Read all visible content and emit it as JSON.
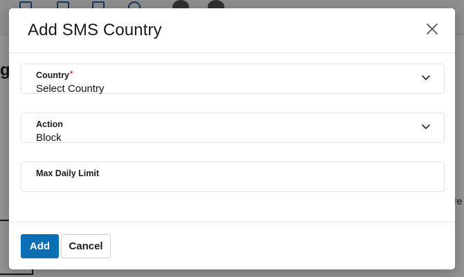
{
  "modal": {
    "title": "Add SMS Country",
    "close_icon": "close-icon"
  },
  "fields": {
    "country": {
      "label": "Country",
      "required_marker": "*",
      "value": "Select Country",
      "icon": "chevron-down-icon"
    },
    "action": {
      "label": "Action",
      "value": "Block",
      "icon": "chevron-down-icon"
    },
    "max_daily_limit": {
      "label": "Max Daily Limit",
      "value": ""
    }
  },
  "buttons": {
    "add_label": "Add",
    "cancel_label": "Cancel"
  },
  "background": {
    "heading_fragment": "g",
    "side_text_fragment": "re"
  },
  "colors": {
    "primary": "#0a6fb5",
    "required": "#d0232f",
    "overlay": "rgba(0,0,0,0.42)"
  }
}
